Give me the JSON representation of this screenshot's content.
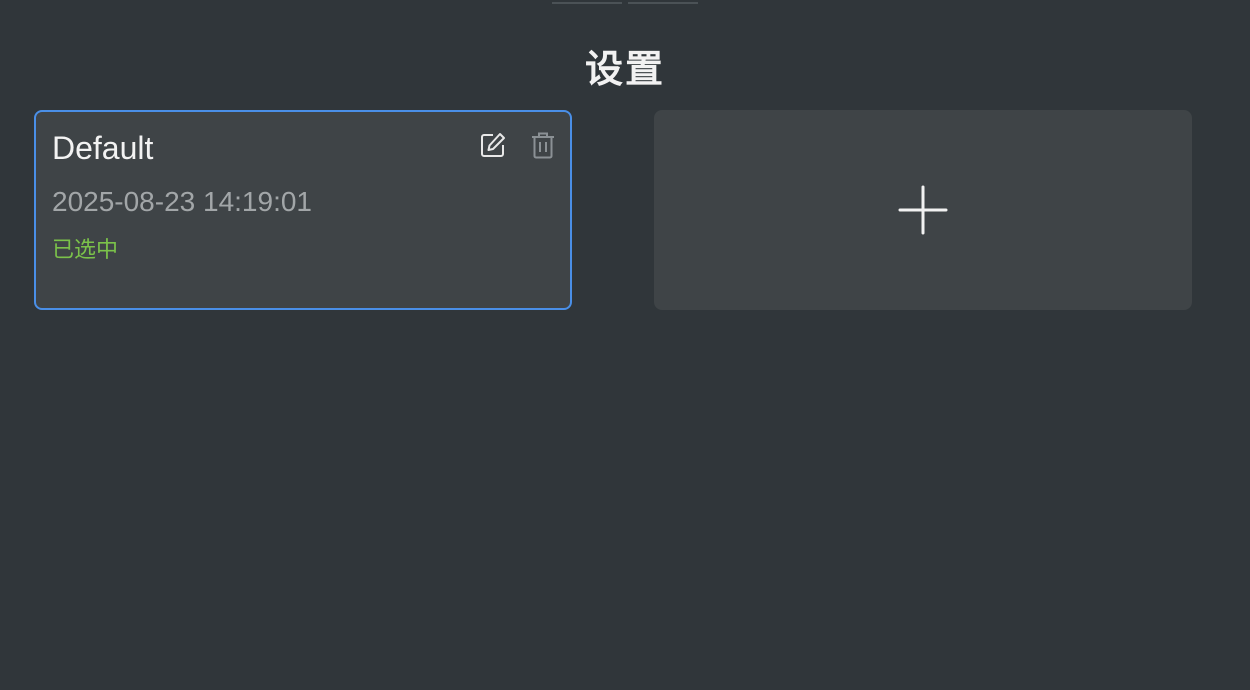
{
  "page": {
    "title": "设置"
  },
  "profile_card": {
    "name": "Default",
    "date": "2025-08-23 14:19:01",
    "status": "已选中",
    "actions": {
      "edit_icon": "edit-icon",
      "delete_icon": "trash-icon"
    }
  },
  "add_card": {
    "icon": "plus-icon"
  },
  "colors": {
    "background": "#30363a",
    "card": "#3f4447",
    "selected_border": "#4a8fe7",
    "status_green": "#7bc24a",
    "date_gray": "#a2a6a8"
  }
}
